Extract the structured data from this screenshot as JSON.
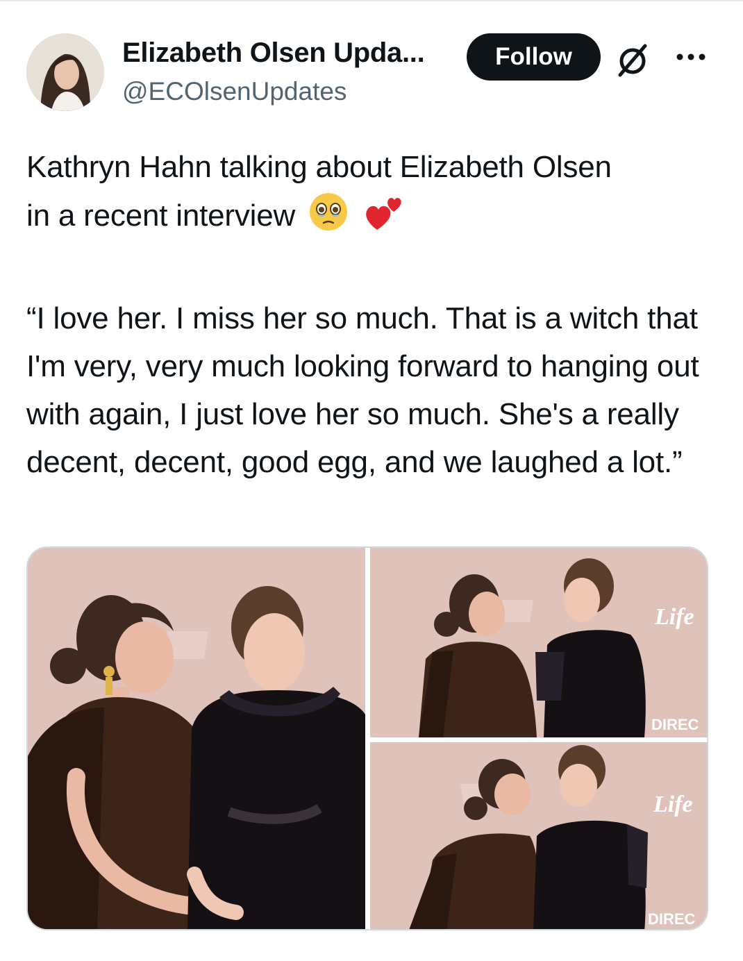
{
  "post": {
    "author": {
      "display_name": "Elizabeth Olsen Upda...",
      "handle": "@ECOlsenUpdates"
    },
    "follow_label": "Follow",
    "icons": {
      "grok": "grok-icon",
      "more": "more-options-icon"
    },
    "text": {
      "line_1": "Kathryn Hahn talking about Elizabeth Olsen",
      "line_2": "in a recent interview",
      "emojis": [
        "face-holding-back-tears-emoji",
        "two-hearts-emoji"
      ],
      "quote": "“I love her. I miss her so much. That is a witch that I'm very, very much looking forward to hanging out with again, I just love her so much. She's a really decent, decent, good egg, and we laughed a lot.”"
    },
    "media": {
      "photo_count": 3,
      "backdrop_signs": {
        "top_right_brand": "Life",
        "top_right_footer": "DIREC",
        "bottom_right_brand": "Life",
        "bottom_right_footer": "DIREC"
      }
    },
    "colors": {
      "text": "#0f1419",
      "secondary_text": "#536471",
      "follow_button_bg": "#0f1419",
      "backdrop_pink": "#dfc3bb"
    }
  }
}
